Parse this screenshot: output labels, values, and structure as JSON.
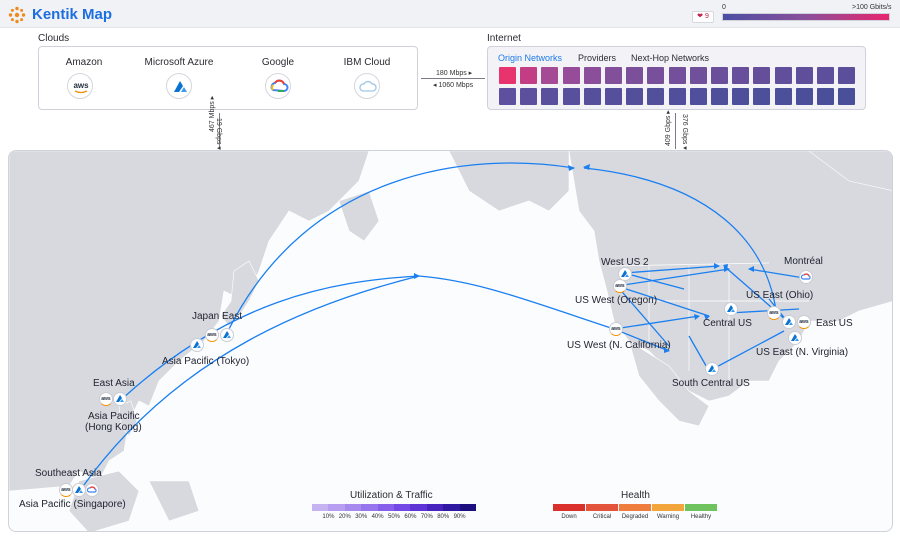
{
  "header": {
    "title": "Kentik Map",
    "alert_count": "9",
    "scale_min": "0",
    "scale_max": ">100 Gbits/s"
  },
  "clouds": {
    "label": "Clouds",
    "items": [
      {
        "name": "Amazon",
        "icon": "aws-icon",
        "icon_text": "aws",
        "color": "#f29100"
      },
      {
        "name": "Microsoft Azure",
        "icon": "azure-icon",
        "color": "#0a72d1"
      },
      {
        "name": "Google",
        "icon": "google-cloud-icon",
        "color": "#4285f4"
      },
      {
        "name": "IBM Cloud",
        "icon": "ibm-cloud-icon",
        "color": "#9ec6e8"
      }
    ]
  },
  "internet": {
    "label": "Internet",
    "tabs": [
      "Origin Networks",
      "Providers",
      "Next-Hop Networks"
    ],
    "active_tab": "Origin Networks",
    "row1_colors": [
      "#e8346e",
      "#c23d83",
      "#a54b95",
      "#964c98",
      "#8a4e9a",
      "#824f9b",
      "#7c4f9b",
      "#784f9b",
      "#744f9b",
      "#704f9b",
      "#6c4f9b",
      "#684f9b",
      "#654f9b",
      "#624f9b",
      "#5f4f9b",
      "#5d4f9b",
      "#5b4f9b",
      "#594f9b",
      "#574f9b",
      "#564f9b"
    ],
    "row2_colors": [
      "#5f4f9f",
      "#5c4f9e",
      "#5a4f9d",
      "#584f9d",
      "#564f9c",
      "#554f9c",
      "#534f9b",
      "#524f9b",
      "#514f9b",
      "#504f9b",
      "#4f4f9b",
      "#4e4f9b",
      "#4d4f9a",
      "#4c4f9a",
      "#4b4f9a",
      "#4b4f9a",
      "#4a4f9a",
      "#4a4f9a",
      "#494f9a",
      "#494f9a"
    ]
  },
  "links": {
    "clouds_internet_top": "180 Mbps ▸",
    "clouds_internet_bottom": "◂ 1060 Mbps",
    "clouds_map_left": "467 Mbps ▸",
    "clouds_map_right": "19 Gbps ▾",
    "internet_map_left": "409 Gbps ▸",
    "internet_map_right": "376 Gbps ▾"
  },
  "map": {
    "labels": {
      "japan_east": "Japan East",
      "asia_pacific_tokyo": "Asia Pacific (Tokyo)",
      "east_asia": "East Asia",
      "asia_pacific_hk_1": "Asia Pacific",
      "asia_pacific_hk_2": "(Hong Kong)",
      "southeast_asia": "Southeast Asia",
      "asia_pacific_singapore": "Asia Pacific (Singapore)",
      "west_us_2": "West US 2",
      "us_west_oregon": "US West (Oregon)",
      "us_west_n_california": "US West (N. California)",
      "central_us": "Central US",
      "us_east_ohio": "US East (Ohio)",
      "montreal": "Montréal",
      "east_us": "East US",
      "us_east_n_virginia": "US East (N. Virginia)",
      "south_central_us": "South Central US"
    },
    "arc_color": "#1a7ff0"
  },
  "legend": {
    "utilization_title": "Utilization & Traffic",
    "utilization_ticks": [
      "10%",
      "20%",
      "30%",
      "40%",
      "50%",
      "60%",
      "70%",
      "80%",
      "90%"
    ],
    "utilization_colors": [
      "#c6b3f2",
      "#b79ef0",
      "#a78aee",
      "#9775ec",
      "#8660ea",
      "#7448e5",
      "#5f34d6",
      "#4824bf",
      "#2f18a2",
      "#1d0f7f"
    ],
    "health_title": "Health",
    "health_items": [
      {
        "label": "Down",
        "color": "#d9302c"
      },
      {
        "label": "Critical",
        "color": "#e4533b"
      },
      {
        "label": "Degraded",
        "color": "#ef7d3e"
      },
      {
        "label": "Warning",
        "color": "#f1a53a"
      },
      {
        "label": "Healthy",
        "color": "#6ec35f"
      }
    ]
  }
}
